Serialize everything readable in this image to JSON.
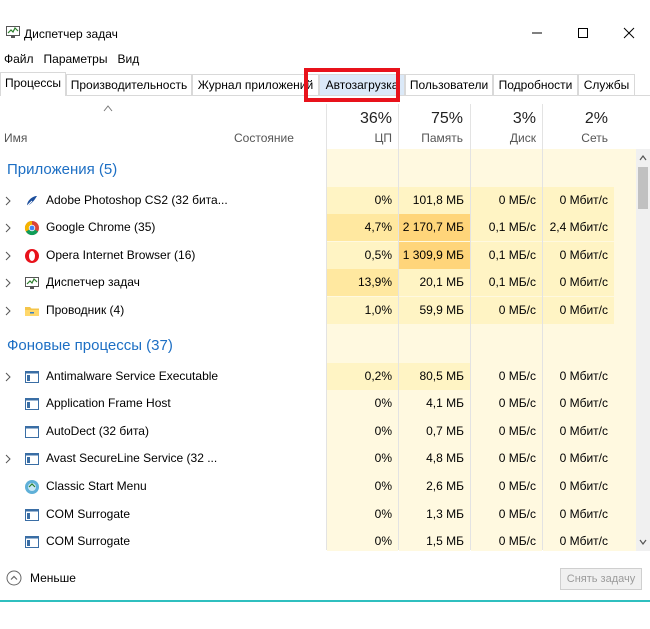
{
  "window": {
    "title": "Диспетчер задач"
  },
  "menu": [
    "Файл",
    "Параметры",
    "Вид"
  ],
  "tabs": [
    "Процессы",
    "Производительность",
    "Журнал приложений",
    "Автозагрузка",
    "Пользователи",
    "Подробности",
    "Службы"
  ],
  "columns": {
    "name": "Имя",
    "status": "Состояние",
    "cpu": {
      "pct": "36%",
      "label": "ЦП"
    },
    "mem": {
      "pct": "75%",
      "label": "Память"
    },
    "disk": {
      "pct": "3%",
      "label": "Диск"
    },
    "net": {
      "pct": "2%",
      "label": "Сеть"
    }
  },
  "groups": {
    "apps": "Приложения (5)",
    "background": "Фоновые процессы (37)"
  },
  "apps": [
    {
      "name": "Adobe Photoshop CS2 (32 бита...",
      "cpu": "0%",
      "mem": "101,8 МБ",
      "disk": "0 МБ/с",
      "net": "0 Мбит/с"
    },
    {
      "name": "Google Chrome (35)",
      "cpu": "4,7%",
      "mem": "2 170,7 МБ",
      "disk": "0,1 МБ/с",
      "net": "2,4 Мбит/с"
    },
    {
      "name": "Opera Internet Browser (16)",
      "cpu": "0,5%",
      "mem": "1 309,9 МБ",
      "disk": "0,1 МБ/с",
      "net": "0 Мбит/с"
    },
    {
      "name": "Диспетчер задач",
      "cpu": "13,9%",
      "mem": "20,1 МБ",
      "disk": "0,1 МБ/с",
      "net": "0 Мбит/с"
    },
    {
      "name": "Проводник (4)",
      "cpu": "1,0%",
      "mem": "59,9 МБ",
      "disk": "0 МБ/с",
      "net": "0 Мбит/с"
    }
  ],
  "background": [
    {
      "name": "Antimalware Service Executable",
      "cpu": "0,2%",
      "mem": "80,5 МБ",
      "disk": "0 МБ/с",
      "net": "0 Мбит/с"
    },
    {
      "name": "Application Frame Host",
      "cpu": "0%",
      "mem": "4,1 МБ",
      "disk": "0 МБ/с",
      "net": "0 Мбит/с"
    },
    {
      "name": "AutoDect (32 бита)",
      "cpu": "0%",
      "mem": "0,7 МБ",
      "disk": "0 МБ/с",
      "net": "0 Мбит/с"
    },
    {
      "name": "Avast SecureLine Service (32 ...",
      "cpu": "0%",
      "mem": "4,8 МБ",
      "disk": "0 МБ/с",
      "net": "0 Мбит/с"
    },
    {
      "name": "Classic Start Menu",
      "cpu": "0%",
      "mem": "2,6 МБ",
      "disk": "0 МБ/с",
      "net": "0 Мбит/с"
    },
    {
      "name": "COM Surrogate",
      "cpu": "0%",
      "mem": "1,3 МБ",
      "disk": "0 МБ/с",
      "net": "0 Мбит/с"
    },
    {
      "name": "COM Surrogate",
      "cpu": "0%",
      "mem": "1,5 МБ",
      "disk": "0 МБ/с",
      "net": "0 Мбит/с"
    }
  ],
  "footer": {
    "less": "Меньше",
    "end_task": "Снять задачу"
  },
  "colors": {
    "highlight": "#e8121b",
    "group_text": "#1d6fc4",
    "accent_line": "#2fbfbf"
  }
}
